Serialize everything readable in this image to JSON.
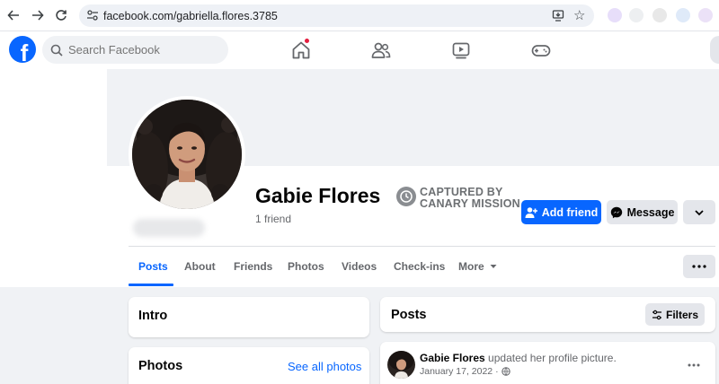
{
  "browser": {
    "url": "facebook.com/gabriella.flores.3785"
  },
  "topbar": {
    "logo_letter": "f",
    "search_placeholder": "Search Facebook",
    "home_has_notification": true
  },
  "profile": {
    "name": "Gabie Flores",
    "friends": "1 friend",
    "stamp_line1": "CAPTURED BY",
    "stamp_line2": "CANARY MISSION",
    "add_friend": "Add friend",
    "message": "Message"
  },
  "tabs": [
    {
      "label": "Posts",
      "active": true
    },
    {
      "label": "About"
    },
    {
      "label": "Friends"
    },
    {
      "label": "Photos"
    },
    {
      "label": "Videos"
    },
    {
      "label": "Check-ins"
    },
    {
      "label": "More"
    }
  ],
  "intro": {
    "title": "Intro"
  },
  "photos": {
    "title": "Photos",
    "see_all": "See all photos"
  },
  "posts": {
    "title": "Posts",
    "filters": "Filters",
    "items": [
      {
        "author": "Gabie Flores",
        "action": "updated her profile picture.",
        "date": "January 17, 2022",
        "dot": "·"
      }
    ]
  },
  "colors": {
    "brand": "#0866ff",
    "notification": "#e41e3f",
    "page_bg": "#f0f2f5"
  }
}
